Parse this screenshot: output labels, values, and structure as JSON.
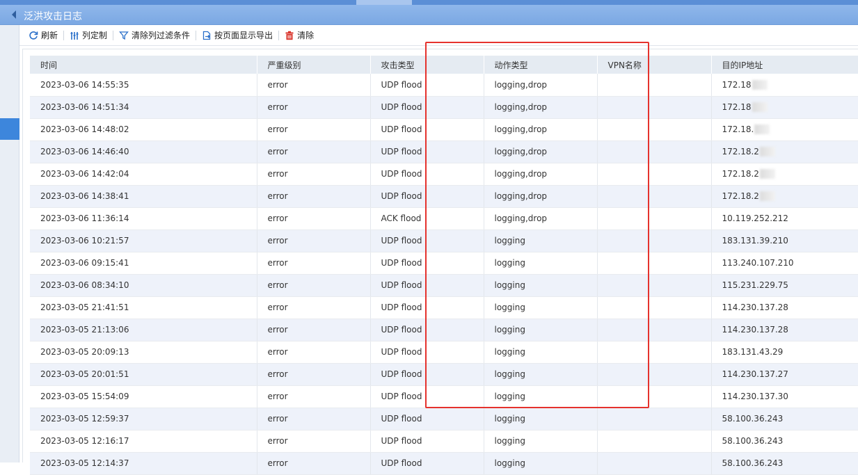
{
  "window": {
    "title": "泛洪攻击日志"
  },
  "toolbar": {
    "refresh": "刷新",
    "columns": "列定制",
    "clear_filters": "清除列过滤条件",
    "export": "按页面显示导出",
    "clear": "清除"
  },
  "table": {
    "headers": [
      "时间",
      "严重级别",
      "攻击类型",
      "动作类型",
      "VPN名称",
      "目的IP地址"
    ],
    "rows": [
      [
        "2023-03-06 14:55:35",
        "error",
        "UDP flood",
        "logging,drop",
        "",
        "172.18"
      ],
      [
        "2023-03-06 14:51:34",
        "error",
        "UDP flood",
        "logging,drop",
        "",
        "172.18"
      ],
      [
        "2023-03-06 14:48:02",
        "error",
        "UDP flood",
        "logging,drop",
        "",
        "172.18."
      ],
      [
        "2023-03-06 14:46:40",
        "error",
        "UDP flood",
        "logging,drop",
        "",
        "172.18.2"
      ],
      [
        "2023-03-06 14:42:04",
        "error",
        "UDP flood",
        "logging,drop",
        "",
        "172.18.2"
      ],
      [
        "2023-03-06 14:38:41",
        "error",
        "UDP flood",
        "logging,drop",
        "",
        "172.18.2"
      ],
      [
        "2023-03-06 11:36:14",
        "error",
        "ACK flood",
        "logging,drop",
        "",
        "10.119.252.212"
      ],
      [
        "2023-03-06 10:21:57",
        "error",
        "UDP flood",
        "logging",
        "",
        "183.131.39.210"
      ],
      [
        "2023-03-06 09:15:41",
        "error",
        "UDP flood",
        "logging",
        "",
        "113.240.107.210"
      ],
      [
        "2023-03-06 08:34:10",
        "error",
        "UDP flood",
        "logging",
        "",
        "115.231.229.75"
      ],
      [
        "2023-03-05 21:41:51",
        "error",
        "UDP flood",
        "logging",
        "",
        "114.230.137.28"
      ],
      [
        "2023-03-05 21:13:06",
        "error",
        "UDP flood",
        "logging",
        "",
        "114.230.137.28"
      ],
      [
        "2023-03-05 20:09:13",
        "error",
        "UDP flood",
        "logging",
        "",
        "183.131.43.29"
      ],
      [
        "2023-03-05 20:01:51",
        "error",
        "UDP flood",
        "logging",
        "",
        "114.230.137.27"
      ],
      [
        "2023-03-05 15:54:09",
        "error",
        "UDP flood",
        "logging",
        "",
        "114.230.137.30"
      ],
      [
        "2023-03-05 12:59:37",
        "error",
        "UDP flood",
        "logging",
        "",
        "58.100.36.243"
      ],
      [
        "2023-03-05 12:16:17",
        "error",
        "UDP flood",
        "logging",
        "",
        "58.100.36.243"
      ],
      [
        "2023-03-05 12:14:37",
        "error",
        "UDP flood",
        "logging",
        "",
        "58.100.36.243"
      ]
    ]
  },
  "colors": {
    "accent": "#3d86dc",
    "title_bar": "#7ba8e3",
    "highlight_box": "#e5322d",
    "clear_icon": "#d9342b"
  },
  "icons": [
    "collapse-arrow-icon",
    "refresh-icon",
    "columns-icon",
    "filter-icon",
    "export-icon",
    "trash-icon"
  ]
}
